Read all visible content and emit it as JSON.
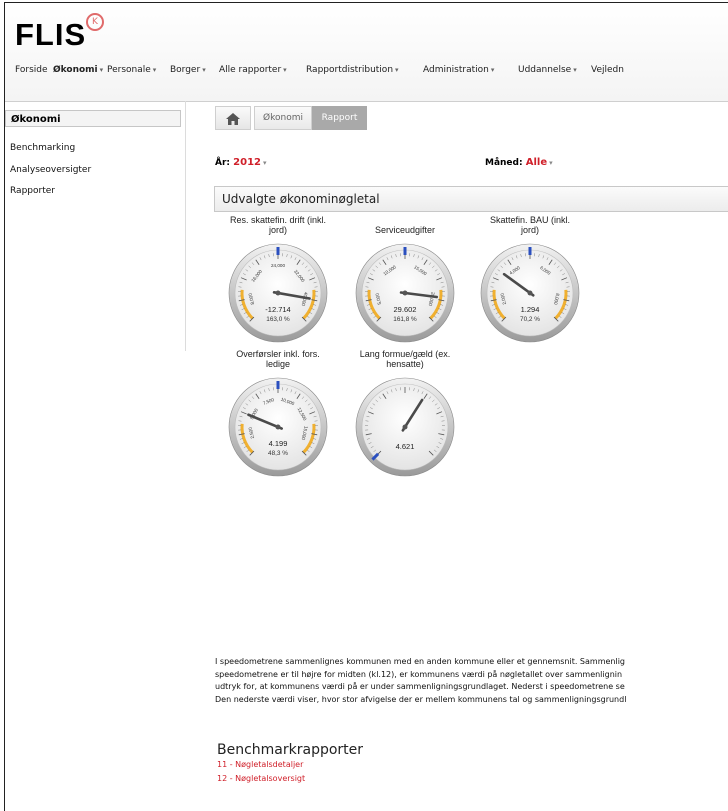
{
  "app": {
    "logo_text": "FLIS",
    "logo_mark": "K"
  },
  "nav": {
    "items": [
      {
        "label": "Forside",
        "has_caret": false
      },
      {
        "label": "Økonomi",
        "has_caret": true,
        "active": true
      },
      {
        "label": "Personale",
        "has_caret": true
      },
      {
        "label": "Borger",
        "has_caret": true
      },
      {
        "label": "Alle rapporter",
        "has_caret": true
      },
      {
        "label": "Rapportdistribution",
        "has_caret": true
      },
      {
        "label": "Administration",
        "has_caret": true
      },
      {
        "label": "Uddannelse",
        "has_caret": true
      },
      {
        "label": "Vejledn",
        "has_caret": false
      }
    ]
  },
  "sidebar": {
    "title": "Økonomi",
    "items": [
      {
        "label": "Benchmarking"
      },
      {
        "label": "Analyseoversigter"
      },
      {
        "label": "Rapporter"
      }
    ]
  },
  "breadcrumb": {
    "home_icon": "home-icon",
    "items": [
      {
        "label": "Økonomi"
      },
      {
        "label": "Rapport"
      }
    ]
  },
  "filters": {
    "year_label": "År:",
    "year_value": "2012",
    "month_label": "Måned:",
    "month_value": "Alle"
  },
  "panel": {
    "title": "Udvalgte økonominøgletal"
  },
  "gauges": [
    {
      "title_lines": [
        "Res. skattefin. drift (inkl.",
        "jord)"
      ],
      "tick_labels": [
        "8,000",
        "16,000",
        "24,000",
        "32,000",
        "40,000"
      ],
      "value": "-12.714",
      "percent": "163,0 %",
      "needle_fraction": 0.87,
      "marker_fraction": 0.5,
      "has_range_bands": true
    },
    {
      "title_lines": [
        "Serviceudgifter"
      ],
      "tick_labels": [
        "5,000",
        "10,000",
        "15,000",
        "20,000"
      ],
      "value": "29.602",
      "percent": "161,8 %",
      "needle_fraction": 0.86,
      "marker_fraction": 0.5,
      "has_range_bands": true
    },
    {
      "title_lines": [
        "Skattefin. BAU (inkl.",
        "jord)"
      ],
      "tick_labels": [
        "2,000",
        "4,000",
        "6,000",
        "8,000"
      ],
      "value": "1.294",
      "percent": "70,2 %",
      "needle_fraction": 0.3,
      "marker_fraction": 0.5,
      "has_range_bands": true
    },
    {
      "title_lines": [
        "Overførsler inkl. fors.",
        "ledige"
      ],
      "tick_labels": [
        "2,500",
        "5,000",
        "7,500",
        "10,000",
        "12,500",
        "15,000"
      ],
      "value": "4.199",
      "percent": "48,3 %",
      "needle_fraction": 0.25,
      "marker_fraction": 0.5,
      "has_range_bands": true
    },
    {
      "title_lines": [
        "Lang formue/gæld (ex.",
        "hensatte)"
      ],
      "tick_labels": [],
      "value": "4.621",
      "percent": "",
      "needle_fraction": 0.62,
      "marker_fraction": 0.0,
      "has_range_bands": false
    }
  ],
  "description": {
    "lines": [
      "I speedometrene sammenlignes kommunen med en anden kommune eller et gennemsnit. Sammenlig",
      "speedometrene er til højre for midten (kl.12), er kommunens værdi på nøgletallet over sammenlignin",
      "udtryk for, at kommunens værdi på er under sammenligningsgrundlaget. Nederst i speedometrene se",
      "Den nederste værdi viser, hvor stor afvigelse der er mellem kommunens tal og sammenligningsgrundl"
    ]
  },
  "benchmark": {
    "title": "Benchmarkrapporter",
    "links": [
      {
        "label": "11 - Nøgletalsdetaljer"
      },
      {
        "label": "12 - Nøgletalsoversigt"
      }
    ]
  },
  "colors": {
    "accent_red": "#d0202a",
    "gauge_band": "#f0b030",
    "gauge_marker": "#2a4fbf"
  }
}
